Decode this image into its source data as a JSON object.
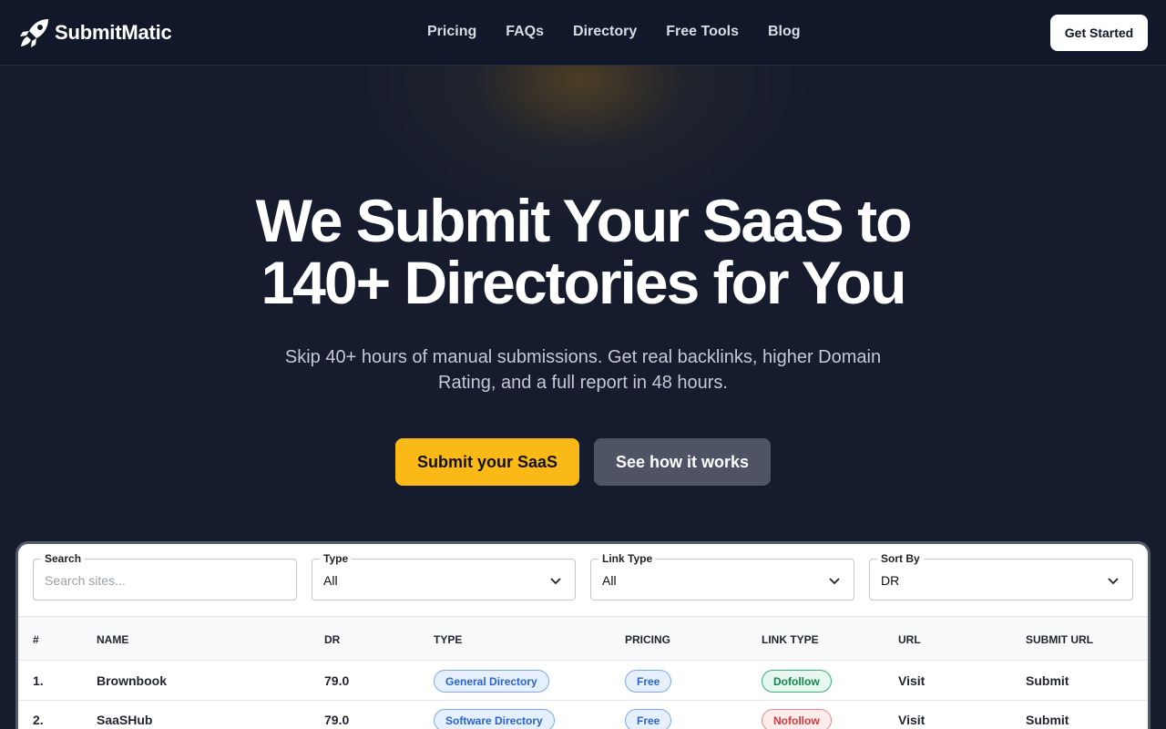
{
  "brand": {
    "name": "SubmitMatic"
  },
  "nav": {
    "items": [
      "Pricing",
      "FAQs",
      "Directory",
      "Free Tools",
      "Blog"
    ],
    "cta": "Get Started"
  },
  "hero": {
    "title_line1": "We Submit Your SaaS to",
    "title_line2": "140+ Directories for You",
    "subtitle": "Skip 40+ hours of manual submissions. Get real backlinks, higher Domain Rating, and a full report in 48 hours.",
    "primary_button": "Submit your SaaS",
    "secondary_button": "See how it works"
  },
  "filters": {
    "search": {
      "label": "Search",
      "placeholder": "Search sites..."
    },
    "type": {
      "label": "Type",
      "value": "All"
    },
    "link_type": {
      "label": "Link Type",
      "value": "All"
    },
    "sort_by": {
      "label": "Sort By",
      "value": "DR"
    }
  },
  "table": {
    "columns": [
      "#",
      "Name",
      "DR",
      "Type",
      "Pricing",
      "Link Type",
      "URL",
      "Submit URL"
    ],
    "rows": [
      {
        "index": "1.",
        "name": "Brownbook",
        "dr": "79.0",
        "type": "General Directory",
        "pricing": "Free",
        "link_type": "Dofollow",
        "url": "Visit",
        "submit": "Submit"
      },
      {
        "index": "2.",
        "name": "SaaSHub",
        "dr": "79.0",
        "type": "Software Directory",
        "pricing": "Free",
        "link_type": "Nofollow",
        "url": "Visit",
        "submit": "Submit"
      }
    ]
  },
  "colors": {
    "accent": "#fbb917",
    "background": "#161c2e",
    "dofollow": "#15864d",
    "nofollow": "#cc3a3a",
    "badge_blue": "#2a64c9"
  }
}
